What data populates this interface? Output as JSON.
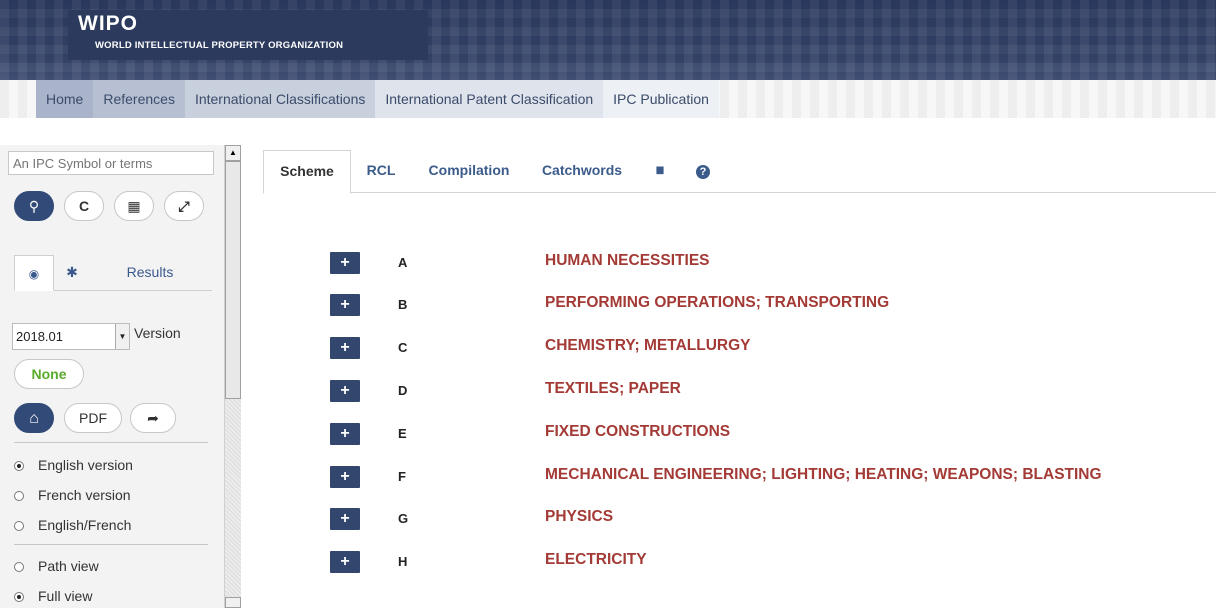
{
  "header": {
    "logo_title": "WIPO",
    "logo_subtitle": "WORLD INTELLECTUAL PROPERTY ORGANIZATION"
  },
  "breadcrumb": [
    {
      "label": "Home"
    },
    {
      "label": "References"
    },
    {
      "label": "International Classifications"
    },
    {
      "label": "International Patent Classification"
    },
    {
      "label": "IPC Publication"
    }
  ],
  "sidebar": {
    "search_placeholder": "An IPC Symbol or terms",
    "buttons": [
      {
        "icon": "search-icon",
        "glyph": "⚲"
      },
      {
        "icon": "reset-icon",
        "glyph": "C"
      },
      {
        "icon": "grid-icon",
        "glyph": "▦"
      },
      {
        "icon": "expand-icon",
        "glyph": "⤢"
      }
    ],
    "tabs": [
      {
        "icon": "eye-icon",
        "glyph": "◉"
      },
      {
        "icon": "gear-icon",
        "glyph": "✱"
      },
      {
        "label": "Results"
      }
    ],
    "version_value": "2018.01",
    "version_label": "Version",
    "none_label": "None",
    "home_glyph": "⌂",
    "pdf_label": "PDF",
    "share_glyph": "➦",
    "language_options": [
      {
        "label": "English version",
        "selected": true
      },
      {
        "label": "French version",
        "selected": false
      },
      {
        "label": "English/French",
        "selected": false
      }
    ],
    "view_options": [
      {
        "label": "Path view",
        "selected": false
      },
      {
        "label": "Full view",
        "selected": true
      }
    ]
  },
  "main_tabs": [
    {
      "label": "Scheme",
      "active": true
    },
    {
      "label": "RCL",
      "active": false
    },
    {
      "label": "Compilation",
      "active": false
    },
    {
      "label": "Catchwords",
      "active": false
    },
    {
      "icon": "book-icon",
      "glyph": "▮▮"
    },
    {
      "icon": "help-icon",
      "glyph": "?"
    }
  ],
  "sections": [
    {
      "code": "A",
      "title": "HUMAN NECESSITIES"
    },
    {
      "code": "B",
      "title": "PERFORMING OPERATIONS; TRANSPORTING"
    },
    {
      "code": "C",
      "title": "CHEMISTRY; METALLURGY"
    },
    {
      "code": "D",
      "title": "TEXTILES; PAPER"
    },
    {
      "code": "E",
      "title": "FIXED CONSTRUCTIONS"
    },
    {
      "code": "F",
      "title": "MECHANICAL ENGINEERING; LIGHTING; HEATING; WEAPONS; BLASTING"
    },
    {
      "code": "G",
      "title": "PHYSICS"
    },
    {
      "code": "H",
      "title": "ELECTRICITY"
    }
  ],
  "colors": {
    "banner": "#2c3a5e",
    "section_title": "#a33a35",
    "expand_button": "#33466e",
    "none_label": "#5aab2a"
  }
}
